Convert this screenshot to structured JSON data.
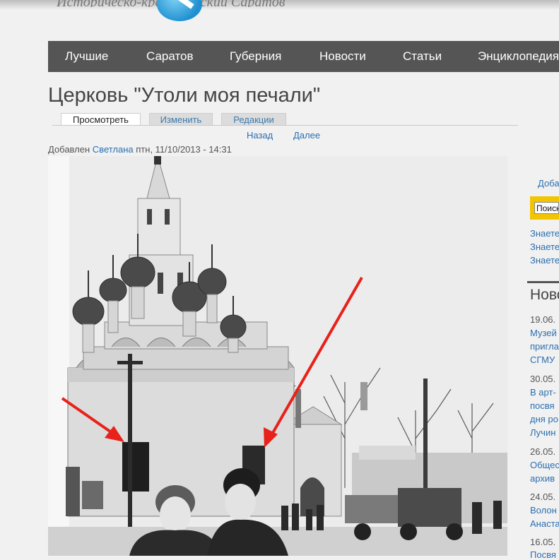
{
  "header": {
    "logo_text": "Историческо-краеведческий Саратов"
  },
  "nav": {
    "items": [
      "Лучшие",
      "Саратов",
      "Губерния",
      "Новости",
      "Статьи",
      "Энциклопедия"
    ]
  },
  "page": {
    "title": "Церковь \"Утоли моя печали\"",
    "tabs": [
      "Просмотреть",
      "Изменить",
      "Редакции"
    ],
    "pager": {
      "back": "Назад",
      "next": "Далее"
    },
    "submitted": {
      "prefix": "Добавлен",
      "author": "Светлана",
      "date": "птн, 11/10/2013 - 14:31"
    }
  },
  "sidebar": {
    "add_link": "Доба",
    "search_value": "Поиск",
    "links": [
      "Знаете",
      "Знаете",
      "Знаете"
    ],
    "news_heading": "Ново",
    "news": [
      {
        "date": "19.06.",
        "lines": [
          "Музей",
          "пригла",
          "СГМУ"
        ]
      },
      {
        "date": "30.05.",
        "lines": [
          "В арт-",
          "посвя",
          "дня ро",
          "Лучин"
        ]
      },
      {
        "date": "26.05.",
        "lines": [
          "Общес",
          "архив"
        ]
      },
      {
        "date": "24.05.",
        "lines": [
          "Волон",
          "Анаста"
        ]
      },
      {
        "date": "16.05.",
        "lines": [
          "Посвя"
        ]
      }
    ]
  },
  "colors": {
    "nav_bg": "#555555",
    "link": "#2b6fb0",
    "search_bg": "#f3c500",
    "arrow": "#e8211a"
  }
}
